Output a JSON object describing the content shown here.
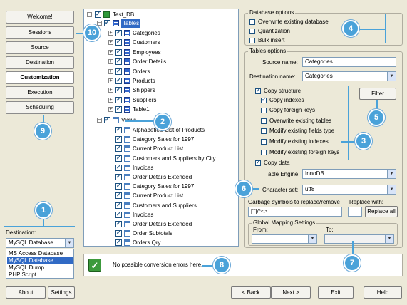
{
  "nav": {
    "items": [
      {
        "label": "Welcome!"
      },
      {
        "label": "Sessions"
      },
      {
        "label": "Source"
      },
      {
        "label": "Destination"
      },
      {
        "label": "Customization"
      },
      {
        "label": "Execution"
      },
      {
        "label": "Scheduling"
      }
    ],
    "active": "Customization"
  },
  "destination": {
    "label": "Destination:",
    "selected": "MySQL Database",
    "options": [
      "MS Access Database",
      "MySQL Database",
      "MySQL Dump",
      "PHP Script"
    ]
  },
  "tree": {
    "root": "Test_DB",
    "tables_node": "Tables",
    "tables": [
      "Categories",
      "Customers",
      "Employees",
      "Order Details",
      "Orders",
      "Products",
      "Shippers",
      "Suppliers",
      "Table1"
    ],
    "views_node": "Views",
    "views": [
      "Alphabetical List of Products",
      "Category Sales for 1997",
      "Current Product List",
      "Customers and Suppliers by City",
      "Invoices",
      "Order Details Extended",
      "Category Sales for 1997",
      "Current Product List",
      "Customers and Suppliers",
      "Invoices",
      "Order Details Extended",
      "Order Subtotals",
      "Orders Qry"
    ]
  },
  "db_options": {
    "title": "Database options",
    "items": [
      {
        "label": "Overwrite existing database",
        "checked": false
      },
      {
        "label": "Quantization",
        "checked": false
      },
      {
        "label": "Bulk insert",
        "checked": false
      }
    ]
  },
  "table_options": {
    "title": "Tables options",
    "source_label": "Source name:",
    "source_value": "Categories",
    "dest_label": "Destination name:",
    "dest_value": "Categories",
    "filter_label": "Filter",
    "checks": [
      {
        "label": "Copy structure",
        "checked": true
      },
      {
        "label": "Copy indexes",
        "checked": true
      },
      {
        "label": "Copy foreign keys",
        "checked": false
      },
      {
        "label": "Overwrite existing tables",
        "checked": false
      },
      {
        "label": "Modify existing fields type",
        "checked": false
      },
      {
        "label": "Modify existing indexes",
        "checked": false
      },
      {
        "label": "Modify existing foreign keys",
        "checked": false
      }
    ],
    "copy_data_label": "Copy data",
    "copy_data_checked": true,
    "engine_label": "Table Engine:",
    "engine_value": "InnoDB",
    "charset_label": "Character set:",
    "charset_value": "utf8"
  },
  "garbage": {
    "label": "Garbage symbols to replace/remove",
    "value": "[\"'|/*<>",
    "replace_label": "Replace with:",
    "replace_value": "_",
    "replace_all": "Replace all"
  },
  "mapping": {
    "title": "Global Mapping Settings",
    "from_label": "From:",
    "to_label": "To:"
  },
  "status": {
    "message": "No possible conversion errors here."
  },
  "buttons": {
    "about": "About",
    "settings": "Settings",
    "back": "< Back",
    "next": "Next >",
    "exit": "Exit",
    "help": "Help"
  },
  "callouts": [
    "1",
    "2",
    "3",
    "4",
    "5",
    "6",
    "7",
    "8",
    "9",
    "10"
  ],
  "colors": {
    "accent": "#4aa2d9",
    "selection": "#316ac5",
    "window_bg": "#ece9d8"
  }
}
